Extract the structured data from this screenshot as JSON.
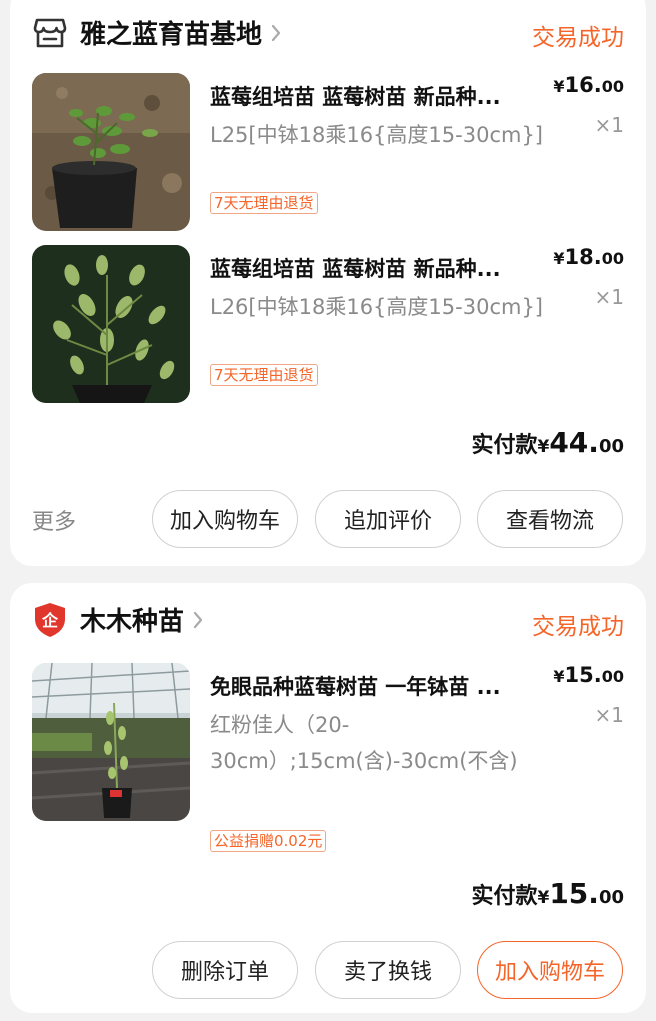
{
  "orders": [
    {
      "shop": {
        "name": "雅之蓝育苗基地",
        "icon": "store-icon"
      },
      "status": "交易成功",
      "items": [
        {
          "title": "蓝莓组培苗  蓝莓树苗  新品种...",
          "spec": "L25[中钵18乘16{高度15-30cm}]",
          "tag": "7天无理由退货",
          "price": {
            "currency": "¥",
            "integer": "16.",
            "decimal": "00"
          },
          "qty": "×1"
        },
        {
          "title": "蓝莓组培苗  蓝莓树苗  新品种...",
          "spec": "L26[中钵18乘16{高度15-30cm}]",
          "tag": "7天无理由退货",
          "price": {
            "currency": "¥",
            "integer": "18.",
            "decimal": "00"
          },
          "qty": "×1"
        }
      ],
      "total": {
        "label": "实付款",
        "currency": "¥",
        "integer": "44.",
        "decimal": "00"
      },
      "more_label": "更多",
      "buttons": [
        "加入购物车",
        "追加评价",
        "查看物流"
      ]
    },
    {
      "shop": {
        "name": "木木种苗",
        "icon": "enterprise-shield-icon",
        "badge": "企"
      },
      "status": "交易成功",
      "items": [
        {
          "title": "免眼品种蓝莓树苗 一年钵苗 ...",
          "spec": "红粉佳人（20-30cm）;15cm(含)-30cm(不含)",
          "tag": "公益捐赠0.02元",
          "price": {
            "currency": "¥",
            "integer": "15.",
            "decimal": "00"
          },
          "qty": "×1"
        }
      ],
      "total": {
        "label": "实付款",
        "currency": "¥",
        "integer": "15.",
        "decimal": "00"
      },
      "buttons": [
        "删除订单",
        "卖了换钱",
        "加入购物车"
      ]
    }
  ],
  "colors": {
    "accent": "#f5652a",
    "shield_red": "#e0362c",
    "background": "#f2f2f2"
  }
}
